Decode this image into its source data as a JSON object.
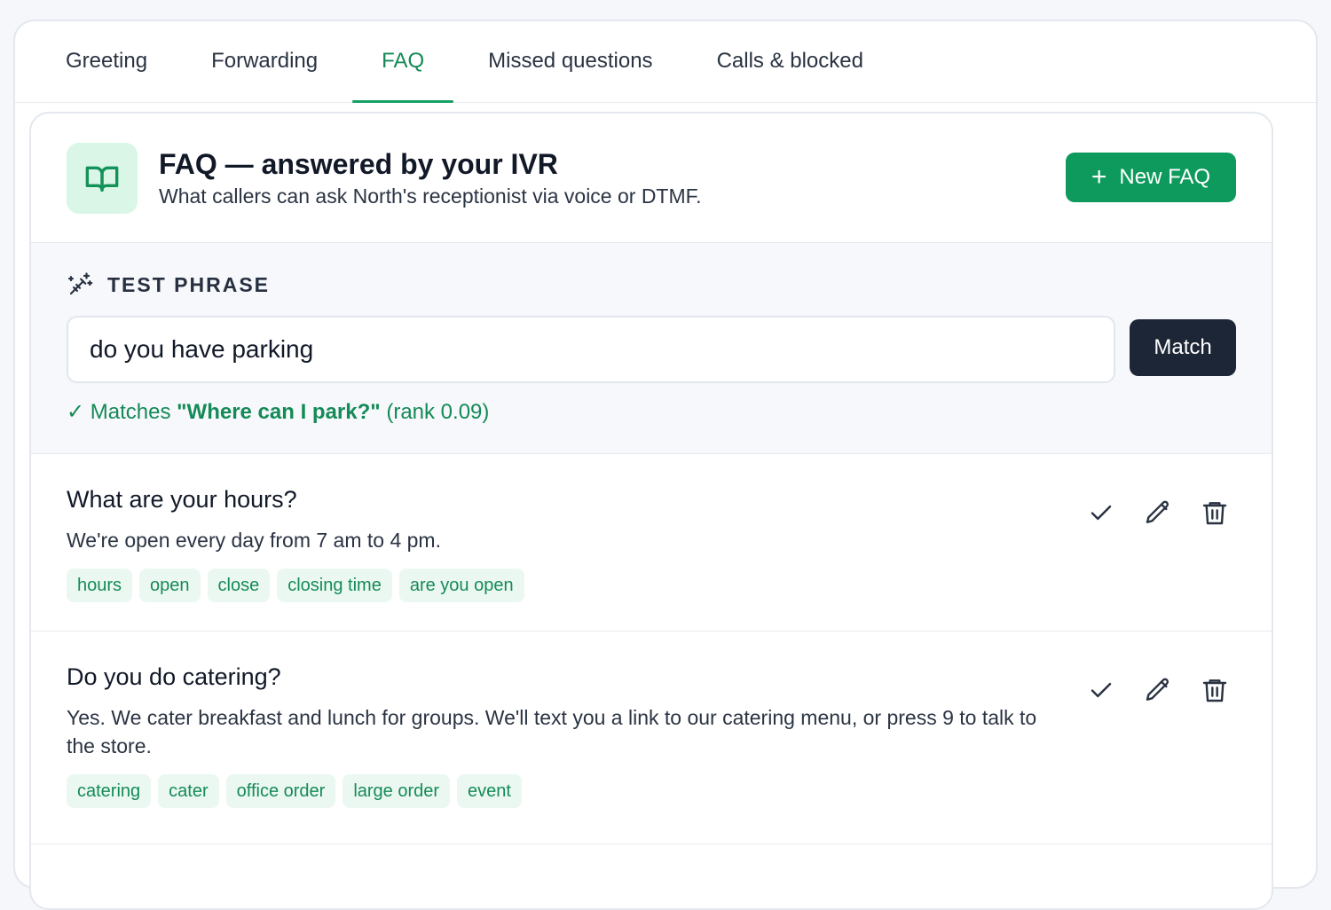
{
  "tabs": [
    {
      "label": "Greeting"
    },
    {
      "label": "Forwarding"
    },
    {
      "label": "FAQ",
      "active": true
    },
    {
      "label": "Missed questions"
    },
    {
      "label": "Calls & blocked"
    }
  ],
  "header": {
    "icon": "book-open-icon",
    "title": "FAQ — answered by your IVR",
    "subtitle": "What callers can ask North's receptionist via voice or DTMF.",
    "new_button_label": "New FAQ"
  },
  "test_phrase": {
    "icon": "magic-wand-icon",
    "label": "TEST PHRASE",
    "value": "do you have parking",
    "match_button_label": "Match",
    "result_prefix": "✓ Matches",
    "result_match": "\"Where can I park?\"",
    "result_rank": "(rank 0.09)"
  },
  "faqs": [
    {
      "question": "What are your hours?",
      "answer": "We're open every day from 7 am to 4 pm.",
      "tags": [
        "hours",
        "open",
        "close",
        "closing time",
        "are you open"
      ]
    },
    {
      "question": "Do you do catering?",
      "answer": "Yes. We cater breakfast and lunch for groups. We'll text you a link to our catering menu, or press 9 to talk to the store.",
      "tags": [
        "catering",
        "cater",
        "office order",
        "large order",
        "event"
      ]
    }
  ],
  "colors": {
    "accent": "#0e9a5d",
    "accent_text": "#148a57",
    "dark_button": "#1d2636",
    "tag_bg": "#ebf8f1"
  }
}
